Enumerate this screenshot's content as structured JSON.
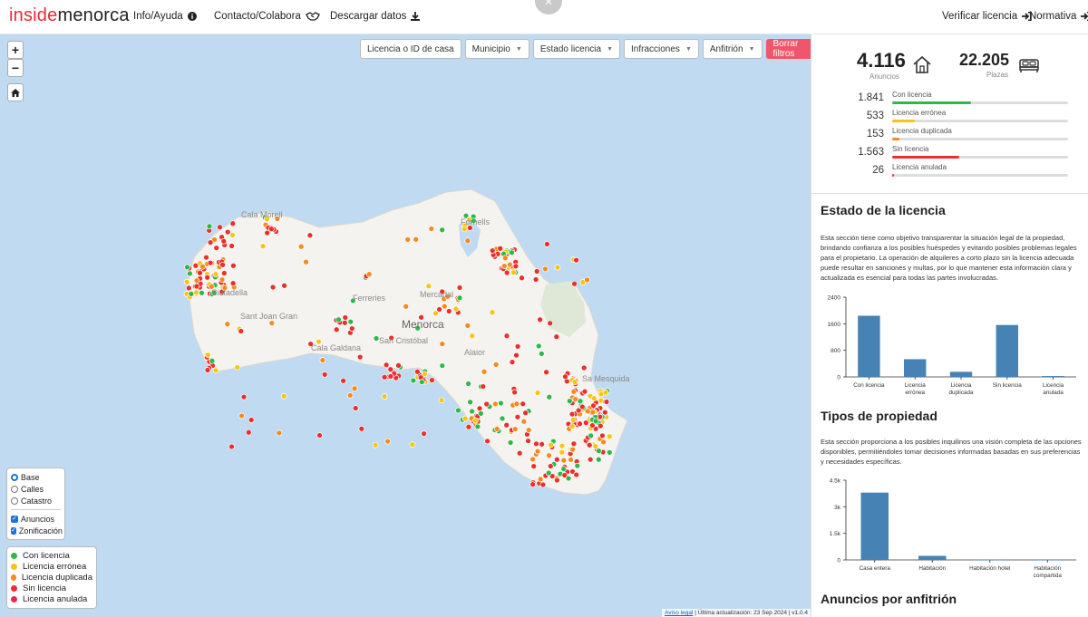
{
  "header": {
    "logo_part1": "inside",
    "logo_part2": "menorca",
    "nav_info": "Info/Ayuda",
    "nav_contact": "Contacto/Colabora",
    "nav_download": "Descargar datos",
    "nav_verify": "Verificar licencia",
    "nav_rules": "Normativa",
    "close_symbol": "×"
  },
  "map": {
    "zoom_in": "+",
    "zoom_out": "−",
    "filters": {
      "search_placeholder": "Licencia o ID de casa",
      "municipio": "Municipio",
      "estado": "Estado licencia",
      "infracciones": "Infracciones",
      "anfitrion": "Anfitrión",
      "clear": "Borrar filtros"
    },
    "labels": {
      "menorca": "Menorca",
      "ferreries": "Ferreries",
      "mercadal": "Mercadal",
      "san_cristobal": "San Cristóbal",
      "sant_joan_gran": "Sant Joan Gran",
      "cala_galdana": "Cala Galdana",
      "alaior": "Alaior",
      "sa_mesquida": "Sa Mesquida",
      "ciutadella": "Ciutadella",
      "fornells": "Fornells",
      "cala_morell": "Cala Morell"
    },
    "layers": {
      "base": "Base",
      "streets": "Calles",
      "cadastre": "Catastro",
      "listings": "Anuncios",
      "zoning": "Zonificación"
    },
    "legend": [
      {
        "label": "Con licencia",
        "color": "#2fb84a"
      },
      {
        "label": "Licencia errónea",
        "color": "#f5c518"
      },
      {
        "label": "Licencia duplicada",
        "color": "#f58a1f"
      },
      {
        "label": "Sin licencia",
        "color": "#e8302c"
      },
      {
        "label": "Licencia anulada",
        "color": "#e8294f"
      }
    ],
    "attribution_link": "Aviso legal",
    "attribution_text": "| Última actualización: 23 Sep 2024 | v1.0.4"
  },
  "summary": {
    "listings_value": "4.116",
    "listings_label": "Anuncios",
    "places_value": "22.205",
    "places_label": "Plazas",
    "rows": [
      {
        "count": "1.841",
        "label": "Con licencia",
        "fraction": 0.45,
        "color": "#2fb84a"
      },
      {
        "count": "533",
        "label": "Licencia errónea",
        "fraction": 0.13,
        "color": "#f5c518"
      },
      {
        "count": "153",
        "label": "Licencia duplicada",
        "fraction": 0.04,
        "color": "#f58a1f"
      },
      {
        "count": "1.563",
        "label": "Sin licencia",
        "fraction": 0.38,
        "color": "#e8302c"
      },
      {
        "count": "26",
        "label": "Licencia anulada",
        "fraction": 0.01,
        "color": "#e8294f"
      }
    ]
  },
  "sections": {
    "license_title": "Estado de la licencia",
    "license_text": "Esta sección tiene como objetivo transparentar la situación legal de la propiedad, brindando confianza a los posibles huéspedes y evitando posibles problemas legales para el propietario. La operación de alquileres a corto plazo sin la licencia adecuada puede resultar en sanciones y multas, por lo que mantener esta información clara y actualizada es esencial para todas las partes involucradas.",
    "property_title": "Tipos de propiedad",
    "property_text": "Esta sección proporciona a los posibles inquilinos una visión completa de las opciones disponibles, permitiéndoles tomar decisiones informadas basadas en sus preferencias y necesidades específicas.",
    "host_title": "Anuncios por anfitrión"
  },
  "chart_data": [
    {
      "type": "bar",
      "categories": [
        "Con licencia",
        "Licencia errónea",
        "Licencia duplicada",
        "Sin licencia",
        "Licencia anulada"
      ],
      "category_lines": [
        [
          "Con licencia"
        ],
        [
          "Licencia",
          "errónea"
        ],
        [
          "Licencia",
          "duplicada"
        ],
        [
          "Sin licencia"
        ],
        [
          "Licencia",
          "anulada"
        ]
      ],
      "values": [
        1841,
        533,
        153,
        1563,
        26
      ],
      "ylim": [
        0,
        2400
      ],
      "yticks": [
        0,
        800,
        1600,
        2400
      ],
      "ytick_labels": [
        "0",
        "800",
        "1600",
        "2400"
      ],
      "title": "",
      "xlabel": "",
      "ylabel": "",
      "color": "#4682b4"
    },
    {
      "type": "bar",
      "categories": [
        "Casa entera",
        "Habitación",
        "Habitación hotel",
        "Habitación compartida"
      ],
      "category_lines": [
        [
          "Casa entera"
        ],
        [
          "Habitación"
        ],
        [
          "Habitación hotel"
        ],
        [
          "Habitación",
          "compartida"
        ]
      ],
      "values": [
        3800,
        230,
        10,
        5
      ],
      "ylim": [
        0,
        4500
      ],
      "yticks": [
        0,
        1500,
        3000,
        4500
      ],
      "ytick_labels": [
        "0",
        "1.5k",
        "3k",
        "4.5k"
      ],
      "title": "",
      "xlabel": "",
      "ylabel": "",
      "color": "#4682b4"
    }
  ]
}
